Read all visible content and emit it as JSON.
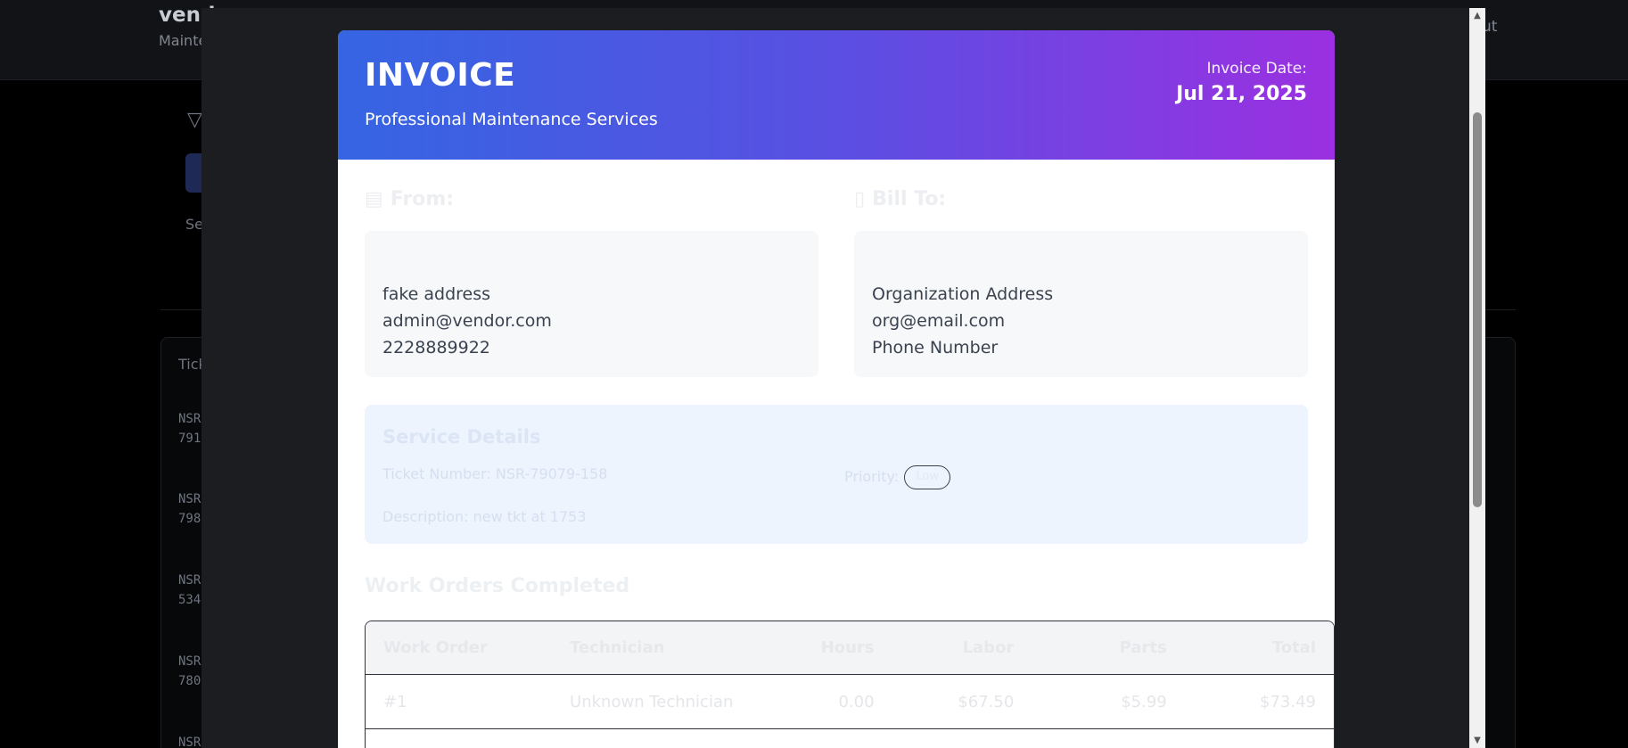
{
  "background": {
    "brand": "vend",
    "subtitle": "Mainte",
    "logout": "ut",
    "filter_label": "Se",
    "table_header": "Ticke",
    "rows": [
      {
        "line1": "NSR",
        "line2": "791"
      },
      {
        "line1": "NSR",
        "line2": "798"
      },
      {
        "line1": "NSR",
        "line2": "534"
      },
      {
        "line1": "NSR",
        "line2": "780"
      },
      {
        "line1": "NSR",
        "line2": ""
      }
    ]
  },
  "invoice": {
    "title": "INVOICE",
    "tagline": "Professional Maintenance Services",
    "date_label": "Invoice Date:",
    "date": "Jul 21, 2025",
    "from": {
      "heading": "From:",
      "icon": "building-icon",
      "address": "fake address",
      "email": "admin@vendor.com",
      "phone": "2228889922"
    },
    "bill_to": {
      "heading": "Bill To:",
      "icon": "document-icon",
      "address": "Organization Address",
      "email": "org@email.com",
      "phone": "Phone Number"
    },
    "service": {
      "heading": "Service Details",
      "ticket": "Ticket Number: NSR-79079-158",
      "priority_label": "Priority:",
      "priority_value": "Low",
      "description": "Description: new tkt at 1753"
    },
    "work_orders": {
      "heading": "Work Orders Completed",
      "columns": [
        "Work Order",
        "Technician",
        "Hours",
        "Labor",
        "Parts",
        "Total"
      ],
      "rows": [
        [
          "#1",
          "Unknown Technician",
          "0.00",
          "$67.50",
          "$5.99",
          "$73.49"
        ]
      ]
    }
  },
  "colors": {
    "header_gradient_start": "#3565e2",
    "header_gradient_end": "#9b30e1",
    "overlay": "#1b1d21",
    "service_bg": "#eef4fe"
  }
}
